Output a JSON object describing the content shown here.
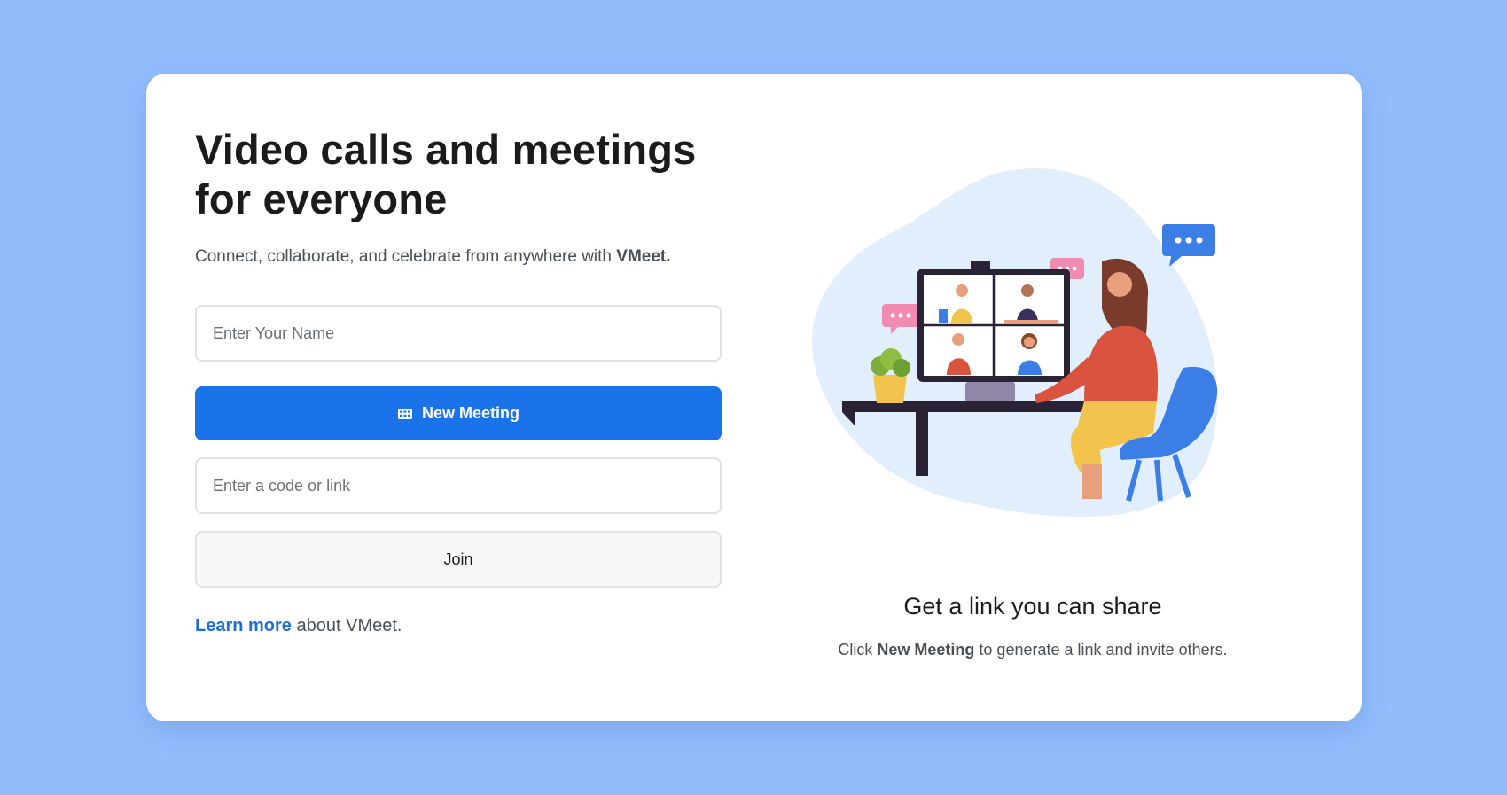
{
  "hero": {
    "title_line1": "Video calls and meetings",
    "title_line2": "for everyone",
    "subtitle_prefix": "Connect, collaborate, and celebrate from anywhere with",
    "subtitle_brand": "VMeet."
  },
  "form": {
    "name_placeholder": "Enter Your Name",
    "new_meeting_label": "New Meeting",
    "code_placeholder": "Enter a code or link",
    "join_label": "Join"
  },
  "learn": {
    "link_label": "Learn more",
    "suffix": "about VMeet."
  },
  "promo": {
    "title": "Get a link you can share",
    "text_prefix": "Click",
    "text_bold": "New Meeting",
    "text_suffix": "to generate a link and invite others."
  },
  "colors": {
    "background": "#91bdfd",
    "primary": "#1a73e8",
    "link": "#1f6fd1"
  },
  "icons": {
    "new_meeting": "video-grid-icon"
  }
}
